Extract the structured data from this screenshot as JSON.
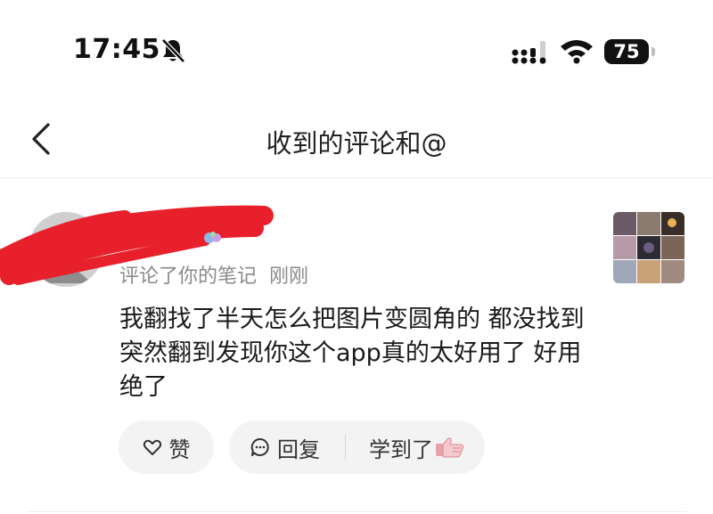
{
  "status_bar": {
    "time": "17:45",
    "battery": "75"
  },
  "nav": {
    "title": "收到的评论和@"
  },
  "comment": {
    "action": "评论了你的笔记",
    "time": "刚刚",
    "text": "我翻找了半天怎么把图片变圆角的 都没找到 突然翻到发现你这个app真的太好用了 好用绝了"
  },
  "actions": {
    "like": "赞",
    "reply": "回复",
    "learned": "学到了"
  },
  "colors": {
    "redaction": "#e8202c",
    "pill_bg": "#f3f3f3",
    "meta_text": "#8a8a8a"
  }
}
